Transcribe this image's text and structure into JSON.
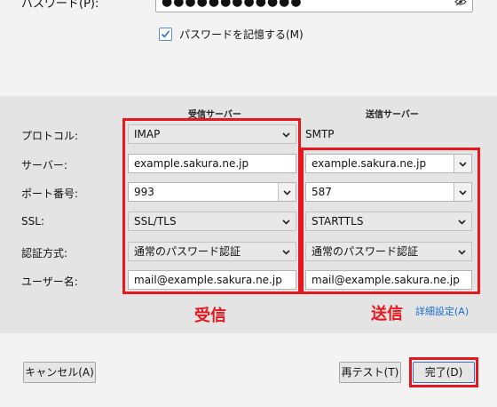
{
  "password": {
    "label": "パスワード(P):",
    "masked_value": "●●●●●●●●●●●●",
    "toggle_icon": "eye-slash-icon"
  },
  "remember_password": {
    "label": "パスワードを記憶する(M)",
    "checked": true
  },
  "columns": {
    "incoming": "受信サーバー",
    "outgoing": "送信サーバー"
  },
  "labels": {
    "protocol": "プロトコル:",
    "server": "サーバー:",
    "port": "ポート番号:",
    "ssl": "SSL:",
    "auth": "認証方式:",
    "username": "ユーザー名:"
  },
  "incoming": {
    "protocol": "IMAP",
    "server": "example.sakura.ne.jp",
    "port": "993",
    "ssl": "SSL/TLS",
    "auth": "通常のパスワード認証",
    "username": "mail@example.sakura.ne.jp"
  },
  "outgoing": {
    "protocol": "SMTP",
    "server": "example.sakura.ne.jp",
    "port": "587",
    "ssl": "STARTTLS",
    "auth": "通常のパスワード認証",
    "username": "mail@example.sakura.ne.jp"
  },
  "annotations": {
    "incoming_label": "受信",
    "outgoing_label": "送信",
    "highlight_color": "#e6171d"
  },
  "advanced_link": "詳細設定(A)",
  "buttons": {
    "cancel": "キャンセル(A)",
    "retest": "再テスト(T)",
    "done": "完了(D)"
  }
}
